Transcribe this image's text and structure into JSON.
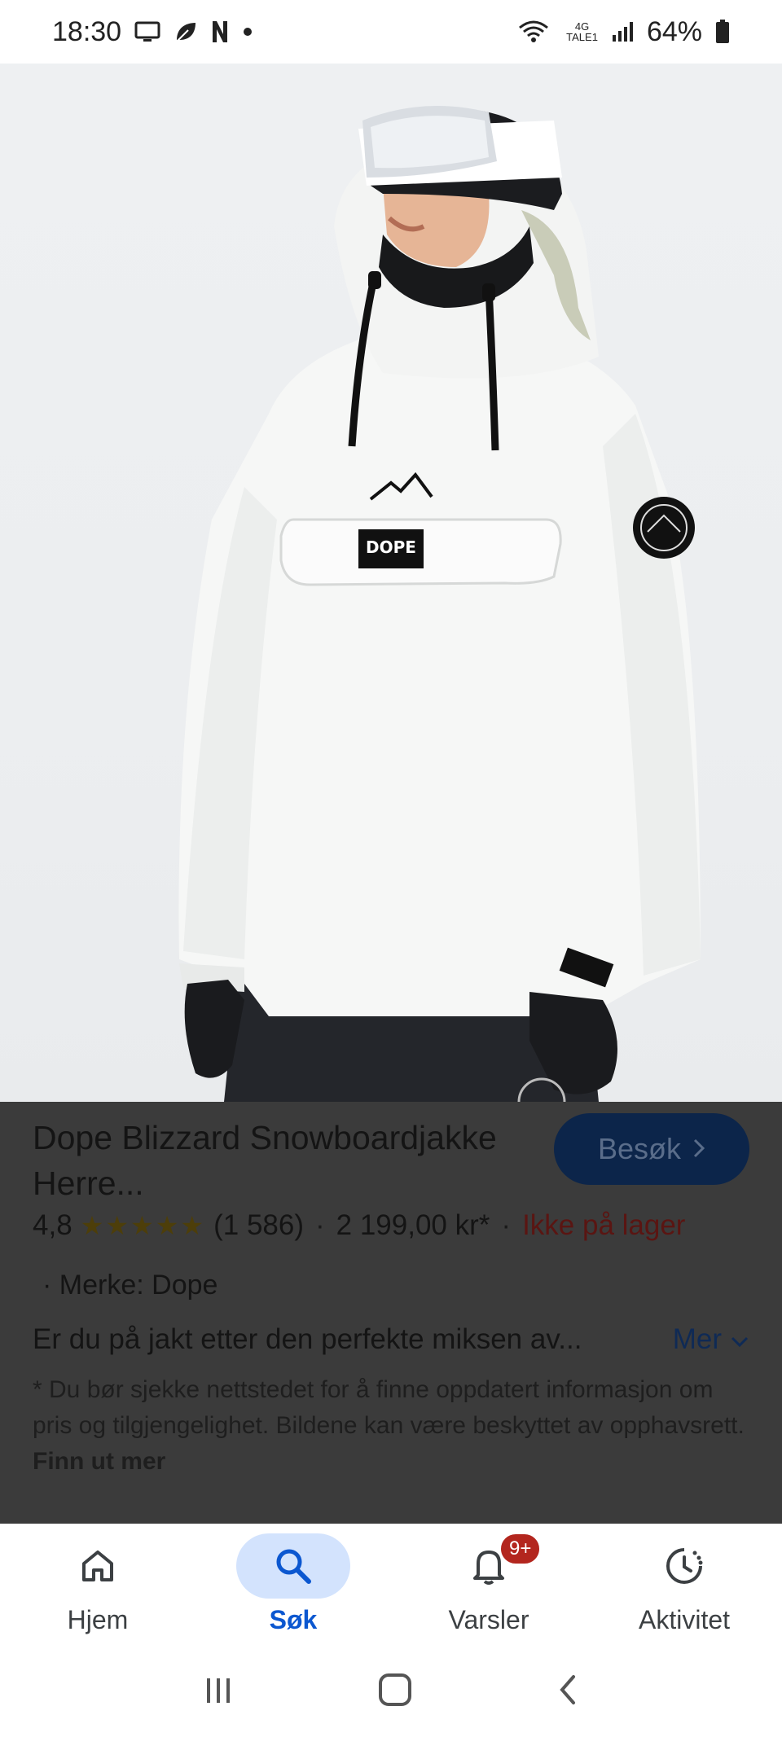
{
  "status_bar": {
    "time": "18:30",
    "battery": "64%",
    "network": {
      "top": "4G",
      "bottom": "TALE1"
    },
    "icons": [
      "tv-icon",
      "leaf-icon",
      "netflix-icon",
      "dot-icon",
      "wifi-icon",
      "signal-icon",
      "battery-icon"
    ]
  },
  "product": {
    "image_alt": "snowboard-jacket-photo",
    "jacket_logo": "DOPE",
    "title": "Dope Blizzard Snowboardjakke Herre...",
    "visit_button": "Besøk",
    "rating": "4,8",
    "stars": "★★★★★",
    "review_count": "(1 586)",
    "price": "2 199,00 kr*",
    "stock_status": "Ikke på lager",
    "brand": "Merke: Dope",
    "description": "Er du på jakt etter den perfekte miksen av...",
    "more_label": "Mer",
    "disclaimer": "* Du bør sjekke nettstedet for å finne oppdatert informasjon om pris og tilgjengelighet. Bildene kan være beskyttet av opphavsrett.",
    "disclaimer_link": "Finn ut mer"
  },
  "bottom_nav": {
    "items": [
      {
        "label": "Hjem",
        "icon": "home-icon",
        "active": false
      },
      {
        "label": "Søk",
        "icon": "search-icon",
        "active": true
      },
      {
        "label": "Varsler",
        "icon": "bell-icon",
        "active": false,
        "badge": "9+"
      },
      {
        "label": "Aktivitet",
        "icon": "activity-icon",
        "active": false
      }
    ]
  },
  "colors": {
    "overlay": "#3b3b3b",
    "accent": "#0b57d0",
    "badge": "#b3261e"
  }
}
